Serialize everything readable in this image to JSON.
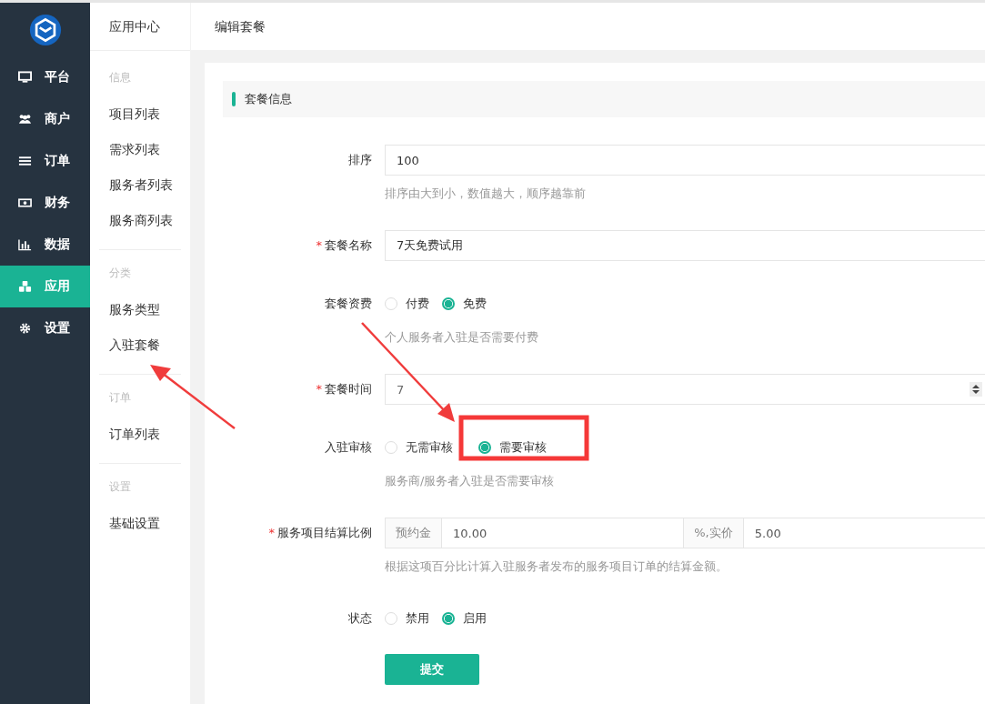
{
  "sidebar": {
    "items": [
      {
        "label": "平台",
        "selected": false
      },
      {
        "label": "商户",
        "selected": false
      },
      {
        "label": "订单",
        "selected": false
      },
      {
        "label": "财务",
        "selected": false
      },
      {
        "label": "数据",
        "selected": false
      },
      {
        "label": "应用",
        "selected": true
      },
      {
        "label": "设置",
        "selected": false
      }
    ]
  },
  "subnav": {
    "title": "应用中心",
    "groups": [
      {
        "heading": "信息",
        "items": [
          {
            "label": "项目列表"
          },
          {
            "label": "需求列表"
          },
          {
            "label": "服务者列表"
          },
          {
            "label": "服务商列表"
          }
        ]
      },
      {
        "heading": "分类",
        "items": [
          {
            "label": "服务类型"
          },
          {
            "label": "入驻套餐"
          }
        ]
      },
      {
        "heading": "订单",
        "items": [
          {
            "label": "订单列表"
          }
        ]
      },
      {
        "heading": "设置",
        "items": [
          {
            "label": "基础设置"
          }
        ]
      }
    ]
  },
  "page": {
    "title": "编辑套餐"
  },
  "section": {
    "title": "套餐信息"
  },
  "form": {
    "fields": [
      {
        "kind": "text",
        "label": "排序",
        "value": "100",
        "help": "排序由大到小，数值越大，顺序越靠前"
      },
      {
        "kind": "text",
        "label": "套餐名称",
        "required_mark": "*",
        "value": "7天免费试用"
      },
      {
        "kind": "radio",
        "label": "套餐资费",
        "options": [
          {
            "label": "付费",
            "selected": false
          },
          {
            "label": "免费",
            "selected": true
          }
        ],
        "help": "个人服务者入驻是否需要付费"
      },
      {
        "kind": "number",
        "label": "套餐时间",
        "required_mark": "*",
        "value": "7"
      },
      {
        "kind": "radio",
        "label": "入驻审核",
        "options": [
          {
            "label": "无需审核",
            "selected": false
          },
          {
            "label": "需要审核",
            "selected": true
          }
        ],
        "help": "服务商/服务者入驻是否需要审核"
      },
      {
        "kind": "split",
        "label": "服务项目结算比例",
        "required_mark": "*",
        "prefix": "预约金",
        "value": "10.00",
        "middle": "%,实价",
        "value2": "5.00",
        "help": "根据这项百分比计算入驻服务者发布的服务项目订单的结算金额。"
      },
      {
        "kind": "radio",
        "label": "状态",
        "options": [
          {
            "label": "禁用",
            "selected": false
          },
          {
            "label": "启用",
            "selected": true
          }
        ]
      }
    ],
    "submit": "提交"
  }
}
